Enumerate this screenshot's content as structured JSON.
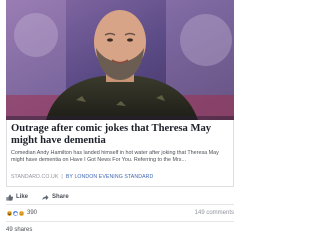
{
  "post": {
    "headline": "Outrage after comic jokes that Theresa May might have dementia",
    "excerpt": "Comedian Andy Hamilton has landed himself in hot water after joking that Theresa May might have dementia on Have I Got News For You. Referring to the Mrs...",
    "source_domain": "STANDARD.CO.UK",
    "source_separator": "|",
    "source_by": "BY LONDON EVENING STANDARD",
    "image_icon": "man-on-tv-show-photo"
  },
  "actions": {
    "like_label": "Like",
    "share_label": "Share"
  },
  "reactions": {
    "icons": [
      "haha-icon",
      "like-icon",
      "sad-icon"
    ],
    "count": "390",
    "comments": "149 comments"
  },
  "shares": "49 shares",
  "colors": {
    "link_blue": "#4267b2",
    "meta_gray": "#90949c",
    "text": "#1d2129"
  }
}
